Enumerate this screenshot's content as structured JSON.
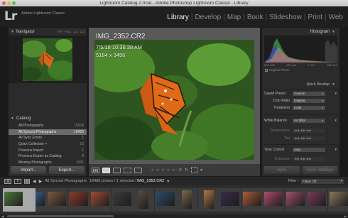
{
  "window": {
    "title": "Lightroom Catalog-2.lrcat - Adobe Photoshop Lightroom Classic - Library"
  },
  "identity": {
    "logo": "Lr",
    "name": "Adobe Lightroom Classic"
  },
  "modules": [
    {
      "label": "Library",
      "active": true
    },
    {
      "label": "Develop"
    },
    {
      "label": "Map"
    },
    {
      "label": "Book"
    },
    {
      "label": "Slideshow"
    },
    {
      "label": "Print"
    },
    {
      "label": "Web"
    }
  ],
  "navigator": {
    "title": "Navigator",
    "options": [
      "FIT",
      "FILL",
      "1:1",
      "1:2"
    ]
  },
  "catalog": {
    "title": "Catalog",
    "items": [
      {
        "label": "All Photographs",
        "count": "19534"
      },
      {
        "label": "All Synced Photographs",
        "count": "18489",
        "selected": true
      },
      {
        "label": "All Sync Errors",
        "count": "1"
      },
      {
        "label": "Quick Collection +",
        "count": "16"
      },
      {
        "label": "Previous Import",
        "count": "1"
      },
      {
        "label": "Previous Export as Catalog",
        "count": "8"
      },
      {
        "label": "Missing Photographs",
        "count": "1031"
      }
    ]
  },
  "left_buttons": {
    "import": "Import...",
    "export": "Export..."
  },
  "photo_info": {
    "filename": "IMG_2352.CR2",
    "datetime": "7/5/18 10:36:38 AM",
    "dimensions": "5184 x 3456"
  },
  "histogram": {
    "title": "Histogram",
    "iso": "ISO 320",
    "focal": "100 mm",
    "aperture": "f / 8.0",
    "shutter": "1/50 sec",
    "original": "Original Photo"
  },
  "quick_develop": {
    "title": "Quick Develop",
    "saved_preset_label": "Saved Preset",
    "saved_preset_value": "Custom",
    "crop_ratio_label": "Crop Ratio",
    "crop_ratio_value": "Original",
    "treatment_label": "Treatment",
    "treatment_value": "Color",
    "white_balance_label": "White Balance",
    "white_balance_value": "As Shot",
    "temperature_label": "Temperature",
    "tint_label": "Tint",
    "tone_control_label": "Tone Control",
    "tone_control_value": "Auto",
    "exposure_label": "Exposure"
  },
  "right_buttons": {
    "sync": "Sync",
    "sync_settings": "Sync Settings"
  },
  "filmstrip_bar": {
    "monitor1": "1",
    "monitor2": "2",
    "source": "All Synced Photographs",
    "count_info": "18489 photos / 1 selected /",
    "current_file": "IMG_2352.CR2",
    "filter_label": "Filter :",
    "filter_value": "Filters Off"
  },
  "filmstrip": {
    "thumbs": [
      {
        "color": "#4c7a3c",
        "selected": true
      },
      {
        "color": "#3f6fa8"
      },
      {
        "color": "#7a5a3c"
      },
      {
        "color": "#8c3a2a"
      },
      {
        "color": "#a14b34"
      },
      {
        "color": "#3c3c3c"
      },
      {
        "color": "#5b4a3a",
        "portrait": true
      },
      {
        "color": "#2b4b6a"
      },
      {
        "color": "#7a6a4a",
        "portrait": true
      },
      {
        "color": "#b07a4a",
        "portrait": true
      },
      {
        "color": "#3a2a4a"
      },
      {
        "color": "#aa5a3a"
      },
      {
        "color": "#b04a6a"
      },
      {
        "color": "#a0506a"
      },
      {
        "color": "#7a3a5a"
      },
      {
        "color": "#8a7a5a"
      }
    ]
  }
}
